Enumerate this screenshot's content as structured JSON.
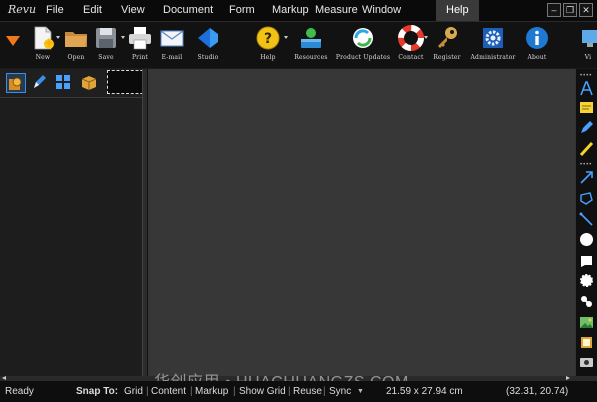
{
  "app": {
    "logo": "Revu"
  },
  "menu": {
    "items": [
      "File",
      "Edit",
      "View",
      "Document",
      "Form",
      "Markup",
      "Measure",
      "Window",
      "Help"
    ],
    "active": "Help"
  },
  "window_controls": {
    "minimize": "–",
    "restore": "❐",
    "close": "✕"
  },
  "toolbar": {
    "new": "New",
    "open": "Open",
    "save": "Save",
    "print": "Print",
    "email": "E-mail",
    "studio": "Studio",
    "help": "Help",
    "resources": "Resources",
    "product_updates": "Product Updates",
    "contact": "Contact",
    "register": "Register",
    "administrator": "Administrator",
    "about": "About",
    "overflow": "Vi"
  },
  "statusbar": {
    "ready": "Ready",
    "snap_to": "Snap To:",
    "grid": "Grid",
    "content": "Content",
    "markup": "Markup",
    "show_grid": "Show Grid",
    "reuse": "Reuse",
    "sync": "Sync",
    "page_size": "21.59 x 27.94 cm",
    "coordinates": "(32.31, 20.74)"
  },
  "watermark": "华创应用 • HUACHUANGZS.COM",
  "colors": {
    "background": "#1b1b1b",
    "canvas": "#373737",
    "accent_blue": "#1e6fd9"
  }
}
